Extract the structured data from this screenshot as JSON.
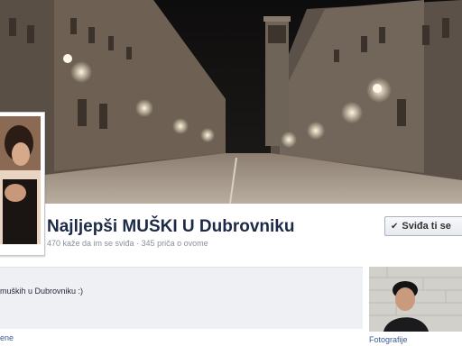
{
  "page": {
    "title": "Najljepši MUŠKI U Dubrovniku",
    "stats": "470 kaže da im se sviđa · 345 priča o ovome",
    "like_button_label": "Sviđa ti se",
    "about_text": "muških u Dubrovniku :)",
    "bottom_left_label": "ene",
    "photos_label": "Fotografije"
  },
  "icons": {
    "like_check": "check-icon"
  }
}
